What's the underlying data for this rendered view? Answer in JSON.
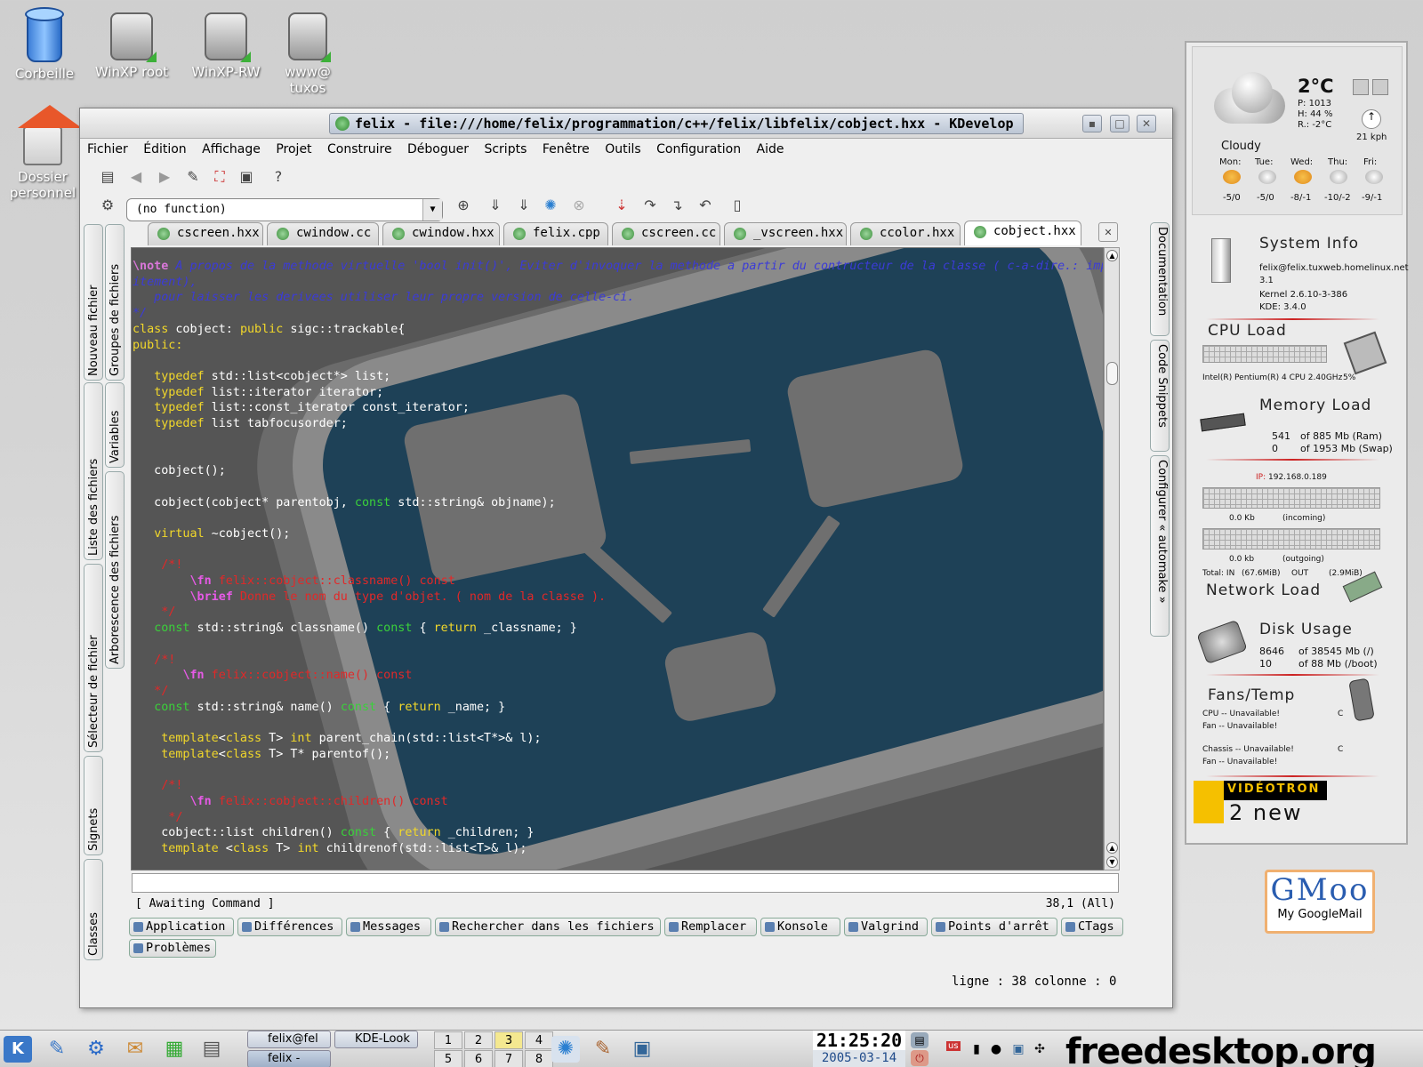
{
  "desktop": {
    "icons": [
      {
        "label": "Corbeille"
      },
      {
        "label": "WinXP root"
      },
      {
        "label": "WinXP-RW"
      },
      {
        "label": "www@ tuxos"
      },
      {
        "label": "Dossier personnel"
      }
    ]
  },
  "window": {
    "title": "felix - file:///home/felix/programmation/c++/felix/libfelix/cobject.hxx - KDevelop",
    "buttons": {
      "minimize": "▪",
      "maximize": "□",
      "close": "✕"
    },
    "menu": [
      "Fichier",
      "Édition",
      "Affichage",
      "Projet",
      "Construire",
      "Déboguer",
      "Scripts",
      "Fenêtre",
      "Outils",
      "Configuration",
      "Aide"
    ],
    "function_combo": "(no function)",
    "left_tabs": [
      "Nouveau fichier",
      "Groupes de fichiers",
      "Liste des fichiers",
      "Variables",
      "Sélecteur de fichier",
      "Arborescence des fichiers",
      "Signets",
      "Classes"
    ],
    "right_tabs": [
      "Documentation",
      "Code Snippets",
      "Configurer « automake »"
    ],
    "file_tabs": [
      "cscreen.hxx",
      "cwindow.cc",
      "cwindow.hxx",
      "felix.cpp",
      "cscreen.cc",
      "_vscreen.hxx",
      "ccolor.hxx",
      "cobject.hxx"
    ],
    "active_tab": "cobject.hxx",
    "command_status": "[ Awaiting Command ]",
    "cursor_pos": "38,1 (All)",
    "bottom_tabs": [
      "Application",
      "Différences",
      "Messages",
      "Rechercher dans les fichiers",
      "Remplacer",
      "Konsole",
      "Valgrind",
      "Points d'arrêt",
      "CTags",
      "Problèmes"
    ],
    "statusbar": "ligne : 38 colonne : 0"
  },
  "code": {
    "note_kw": "\\note",
    "note_l1": " A propos de la methode virtuelle 'bool init()', Eviter d'invoquer la methode a partir du contructeur de la classe ( c-a-dire.: implic",
    "note_l2": "itement),",
    "note_l3": "   pour laisser les derivees utiliser leur propre version de celle-ci.",
    "note_end": "*/",
    "class_kw": "class",
    "class_rest": " cobject: ",
    "public_kw": "public",
    "class_tail": " sigc::trackable{",
    "public_label": "public:",
    "typedef": "typedef",
    "td1": " std::list<cobject*> list;",
    "td2": " list::iterator iterator;",
    "td3": " list::const_iterator const_iterator;",
    "td4": " list tabfocusorder;",
    "ctor1": "   cobject();",
    "ctor2a": "   cobject(cobject* parentobj, ",
    "const": "const",
    "ctor2b": " std::string& objname);",
    "virtual": "virtual",
    "dtor": " ~cobject();",
    "c1_open": "    /*!",
    "fn": "\\fn",
    "fn1": " felix::cobject::classname() const",
    "brief": "\\brief",
    "brief1": " Donne le nom du type d'objet. ( nom de la classe ).",
    "c1_close": "    */",
    "cls_a": " std::string& classname() ",
    "cls_b": " { ",
    "return": "return",
    "cls_c": " _classname; }",
    "c2_open": "   /*!",
    "fn2": " felix::cobject::name() const",
    "c2_close": "   */",
    "name_a": " std::string& name() ",
    "name_c": " _name; }",
    "template": "template",
    "class": "class",
    "int": "int",
    "tpl1": " T> ",
    "tpl1b": " parent_chain(std::list<T*>& l);",
    "tpl2b": " T> T* parentof();",
    "c3_open": "    /*!",
    "fn3": " felix::cobject::children() const",
    "c3_close": "     */",
    "ch_a": "    cobject::list children() ",
    "ch_c": " _children; }",
    "tpl3b": " T> ",
    "tpl3c": " childrenof(std::list<T>& l);"
  },
  "karamba": {
    "temp": "2°C",
    "pressure": "P: 1013",
    "humidity": "H: 44 %",
    "feel": "R.: -2°C",
    "wind": "21 kph",
    "condition": "Cloudy",
    "days": [
      {
        "day": "Mon:",
        "range": "-5/0"
      },
      {
        "day": "Tue:",
        "range": "-5/0"
      },
      {
        "day": "Wed:",
        "range": "-8/-1"
      },
      {
        "day": "Thu:",
        "range": "-10/-2"
      },
      {
        "day": "Fri:",
        "range": "-9/-1"
      }
    ],
    "sysinfo_title": "System Info",
    "host": "felix@felix.tuxweb.homelinux.net",
    "host_ver": "3.1",
    "kernel": "Kernel  2.6.10-3-386",
    "kde": "KDE: 3.4.0",
    "cpu_title": "CPU Load",
    "cpu_name": "Intel(R) Pentium(R) 4 CPU 2.40GHz",
    "cpu_pct": "5%",
    "mem_title": "Memory Load",
    "ram_used": "541",
    "ram_of": "of 885 Mb (Ram)",
    "swap_used": "0",
    "swap_of": "of 1953 Mb (Swap)",
    "ip_label": "IP:",
    "ip": "192.168.0.189",
    "in_kb": "0.0 Kb",
    "in_label": "(incoming)",
    "out_kb": "0.0 kb",
    "out_label": "(outgoing)",
    "total_in_label": "Total: IN",
    "total_in": "(67.6MiB)",
    "total_out_label": "OUT",
    "total_out": "(2.9MiB)",
    "net_title": "Network Load",
    "disk_title": "Disk Usage",
    "disk1_used": "8646",
    "disk1_of": "of 38545 Mb (/)",
    "disk2_used": "10",
    "disk2_of": "of 88 Mb (/boot)",
    "fans_title": "Fans/Temp",
    "cpu_fan1": "CPU  -- Unavailable!",
    "fan1": "Fan  -- Unavailable!",
    "unit_c": "C",
    "chassis": "Chassis  -- Unavailable!",
    "fan2": "Fan  -- Unavailable!",
    "isp": "VIDÉOTRON",
    "isp_sub": "2 new"
  },
  "gmail": {
    "logo": "GMoo",
    "label": "My GoogleMail"
  },
  "taskbar": {
    "tasks": [
      "felix@fel",
      "KDE-Look",
      "felix -"
    ],
    "pager": [
      "1",
      "2",
      "3",
      "4",
      "5",
      "6",
      "7",
      "8"
    ],
    "time": "21:25:20",
    "date": "2005-03-14",
    "lang": "us"
  },
  "watermark": "freedesktop.org"
}
